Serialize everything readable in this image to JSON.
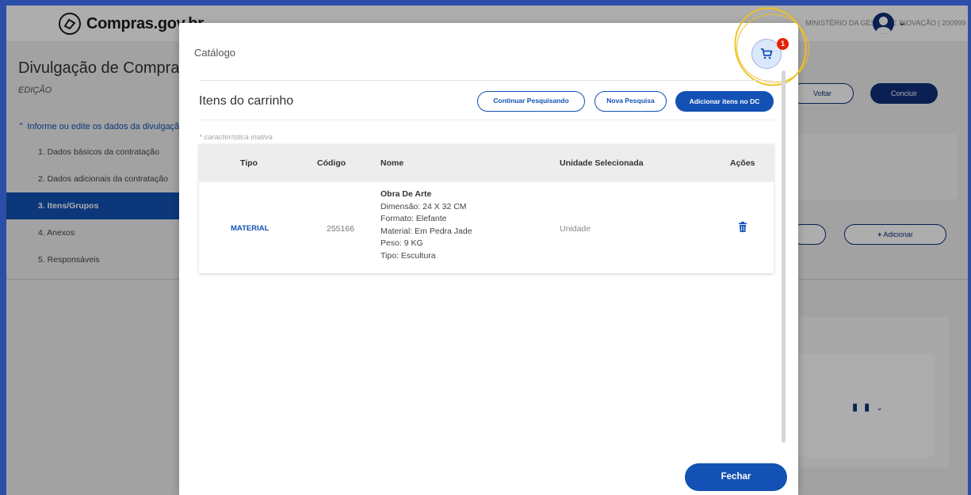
{
  "app": {
    "logo_text": "Compras.gov.br",
    "org_label": "MINISTÉRIO DA GESTÃO E INOVAÇÃO | 200999",
    "page_title": "Divulgação de Compras",
    "page_subtitle": "EDIÇÃO",
    "section_toggle": "Informe ou edite os dados da divulgação",
    "nav": [
      {
        "label": "1. Dados básicos da contratação",
        "active": false
      },
      {
        "label": "2. Dados adicionais da contratação",
        "active": false
      },
      {
        "label": "3. Itens/Grupos",
        "active": true
      },
      {
        "label": "4. Anexos",
        "active": false
      },
      {
        "label": "5. Responsáveis",
        "active": false
      }
    ],
    "voltar_label": "Voltar",
    "concluir_label": "Concluir",
    "adicionar_label": "Adicionar"
  },
  "modal": {
    "title": "Catálogo",
    "cart_count": "1",
    "cart_heading": "Itens do carrinho",
    "buttons": {
      "continue": "Continuar Pesquisando",
      "new_search": "Nova Pesquisa",
      "add_to_dc": "Adicionar itens no DC"
    },
    "note": "* característica inativa",
    "table": {
      "headers": [
        "Tipo",
        "Código",
        "Nome",
        "Unidade Selecionada",
        "Ações"
      ],
      "row": {
        "tipo": "MATERIAL",
        "codigo": "255166",
        "nome_title": "Obra De Arte",
        "nome_lines": [
          "Dimensão: 24 X 32 CM",
          "Formato: Elefante",
          "Material: Em Pedra Jade",
          "Peso: 9 KG",
          "Tipo: Escultura"
        ],
        "unidade": "Unidade"
      }
    },
    "close_label": "Fechar"
  },
  "colors": {
    "primary": "#1351b4",
    "dark_primary": "#0f2f7a",
    "badge": "#e52207",
    "highlight": "#f0c020",
    "frame": "#2c4ea8"
  }
}
